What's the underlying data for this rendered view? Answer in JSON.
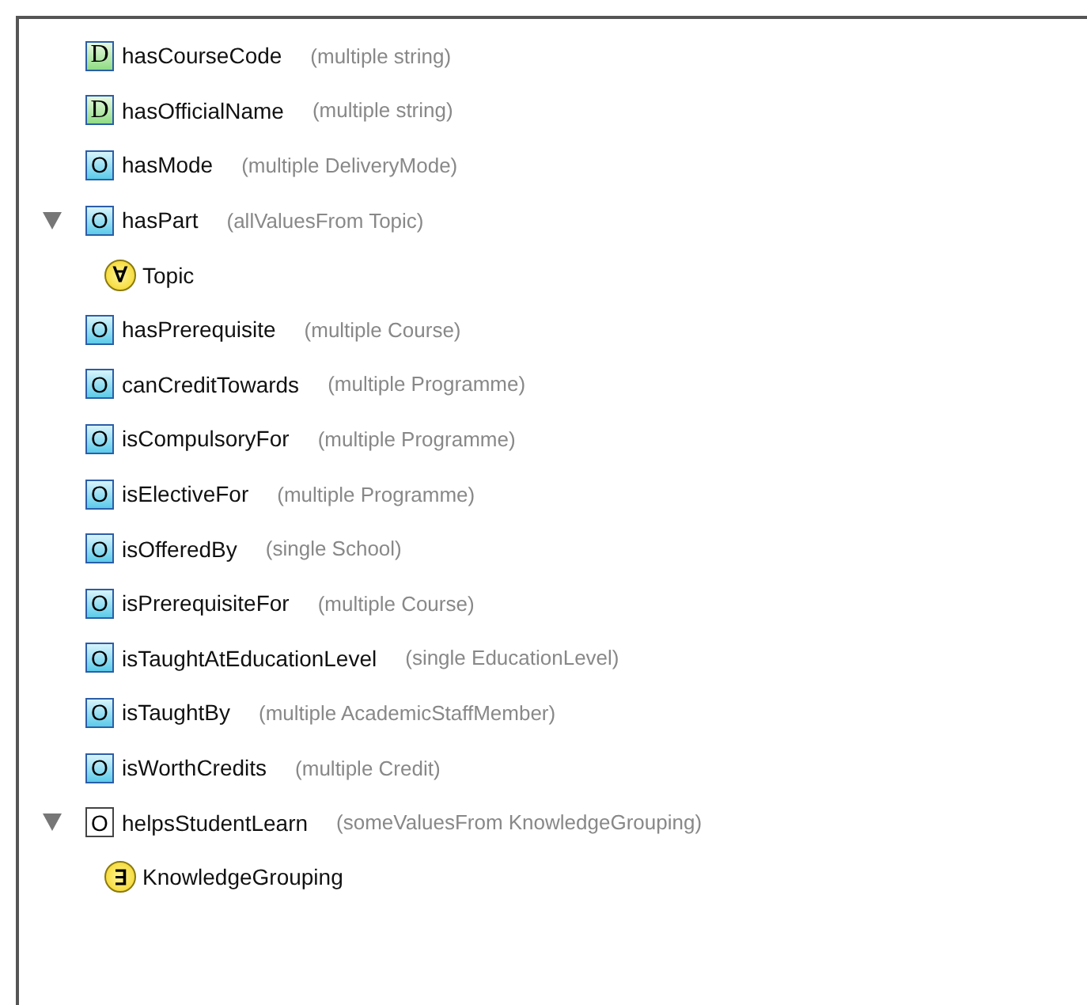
{
  "properties": [
    {
      "kind": "data",
      "badge": "D",
      "name": "hasCourseCode",
      "description": "(multiple string)"
    },
    {
      "kind": "data",
      "badge": "D",
      "name": "hasOfficialName",
      "description": "(multiple string)"
    },
    {
      "kind": "object",
      "badge": "O",
      "name": "hasMode",
      "description": "(multiple DeliveryMode)"
    },
    {
      "kind": "object",
      "badge": "O",
      "name": "hasPart",
      "description": "(allValuesFrom Topic)",
      "expanded": true,
      "children": [
        {
          "badge": "∀",
          "name": "Topic"
        }
      ]
    },
    {
      "kind": "object",
      "badge": "O",
      "name": "hasPrerequisite",
      "description": "(multiple Course)"
    },
    {
      "kind": "object",
      "badge": "O",
      "name": "canCreditTowards",
      "description": "(multiple Programme)"
    },
    {
      "kind": "object",
      "badge": "O",
      "name": "isCompulsoryFor",
      "description": "(multiple Programme)"
    },
    {
      "kind": "object",
      "badge": "O",
      "name": "isElectiveFor",
      "description": "(multiple Programme)"
    },
    {
      "kind": "object",
      "badge": "O",
      "name": "isOfferedBy",
      "description": "(single School)"
    },
    {
      "kind": "object",
      "badge": "O",
      "name": "isPrerequisiteFor",
      "description": "(multiple Course)"
    },
    {
      "kind": "object",
      "badge": "O",
      "name": "isTaughtAtEducationLevel",
      "description": "(single EducationLevel)"
    },
    {
      "kind": "object",
      "badge": "O",
      "name": "isTaughtBy",
      "description": "(multiple AcademicStaffMember)"
    },
    {
      "kind": "object",
      "badge": "O",
      "name": "isWorthCredits",
      "description": "(multiple Credit)"
    },
    {
      "kind": "plain",
      "badge": "O",
      "name": "helpsStudentLearn",
      "description": "(someValuesFrom KnowledgeGrouping)",
      "expanded": true,
      "children": [
        {
          "badge": "∃",
          "name": "KnowledgeGrouping"
        }
      ]
    }
  ]
}
